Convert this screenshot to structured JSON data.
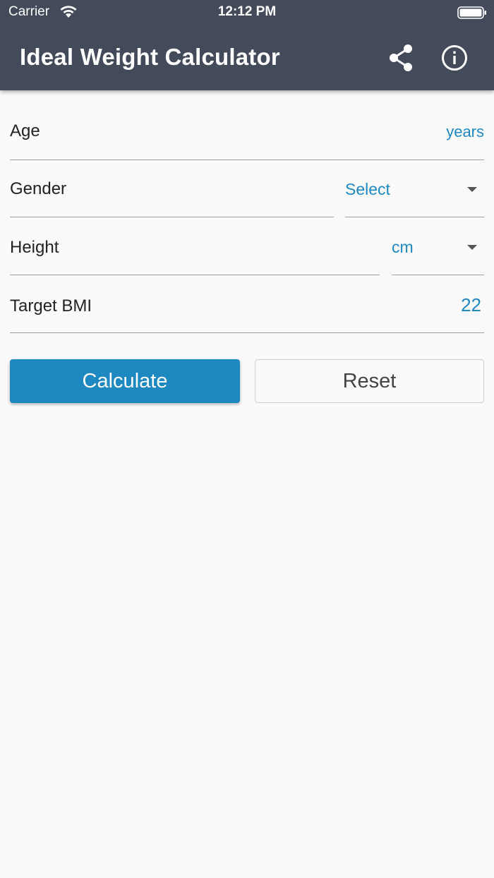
{
  "status_bar": {
    "carrier": "Carrier",
    "time": "12:12 PM"
  },
  "app_bar": {
    "title": "Ideal Weight Calculator",
    "icons": [
      "share-icon",
      "info-icon"
    ],
    "background": "#434a5a"
  },
  "form": {
    "age": {
      "label": "Age",
      "suffix": "years"
    },
    "gender": {
      "label": "Gender",
      "selected": "Select"
    },
    "height": {
      "label": "Height",
      "unit": "cm"
    },
    "target_bmi": {
      "label": "Target BMI",
      "value": "22"
    }
  },
  "buttons": {
    "calculate": "Calculate",
    "reset": "Reset"
  },
  "colors": {
    "accent": "#1e88c0",
    "background": "#fafafa"
  }
}
